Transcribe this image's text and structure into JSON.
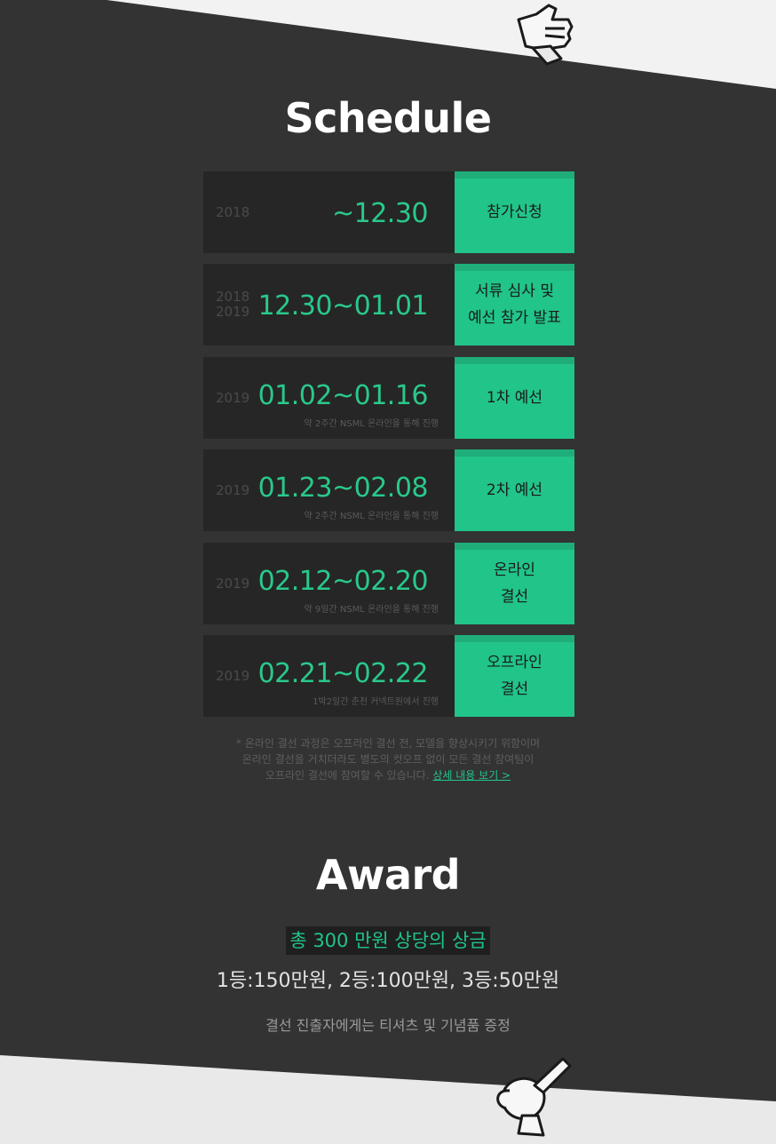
{
  "schedule": {
    "title": "Schedule",
    "rows": [
      {
        "years": [
          "2018"
        ],
        "date": "~12.30",
        "note": "",
        "label": "참가신청"
      },
      {
        "years": [
          "2018",
          "2019"
        ],
        "date": "12.30~01.01",
        "note": "",
        "label": "서류 심사 및\n예선 참가 발표"
      },
      {
        "years": [
          "2019"
        ],
        "date": "01.02~01.16",
        "note": "약 2주간 NSML 온라인을 통해 진행",
        "label": "1차 예선"
      },
      {
        "years": [
          "2019"
        ],
        "date": "01.23~02.08",
        "note": "약 2주간 NSML 온라인을 통해 진행",
        "label": "2차 예선"
      },
      {
        "years": [
          "2019"
        ],
        "date": "02.12~02.20",
        "note": "약 9일간 NSML 온라인을 통해 진행",
        "label": "온라인\n결선"
      },
      {
        "years": [
          "2019"
        ],
        "date": "02.21~02.22",
        "note": "1박2일간 춘천 커넥트원에서 진행",
        "label": "오프라인\n결선"
      }
    ],
    "footnote": {
      "line1": "* 온라인 결선 과정은 오프라인 결선 전, 모델을 향상시키기 위함이며",
      "line2": "온라인 결선을 거치더라도 별도의 컷오프 없이 모든 결선 참여팀이",
      "line3": "오프라인 결선에 참여할 수 있습니다.",
      "link": "상세 내용 보기 >"
    }
  },
  "award": {
    "title": "Award",
    "total": "총 300 만원 상당의 상금",
    "detail": "1등:150만원, 2등:100만원, 3등:50만원",
    "note": "결선 진출자에게는 티셔츠 및 기념품 증정"
  },
  "colors": {
    "accent": "#21c489",
    "background": "#333333"
  },
  "icons": {
    "top": "thumbs-up-icon",
    "bottom": "trophy-icon"
  }
}
